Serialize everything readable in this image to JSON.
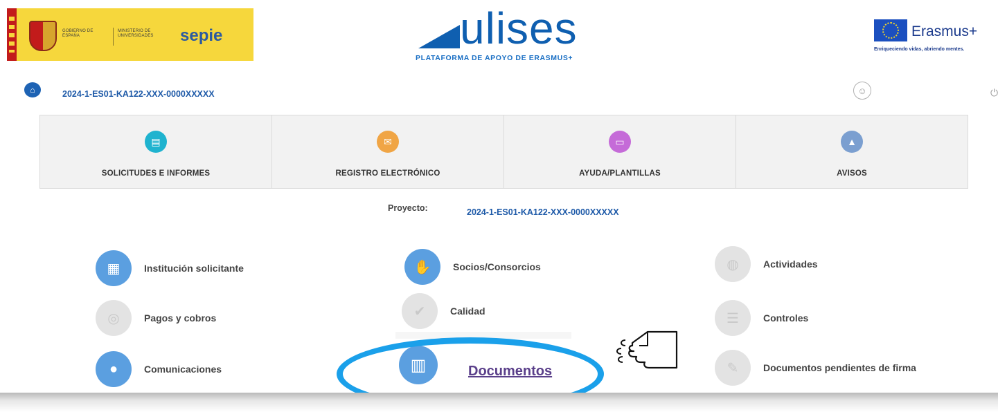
{
  "header": {
    "gov_text_1": "GOBIERNO DE ESPAÑA",
    "gov_text_2": "MINISTERIO DE UNIVERSIDADES",
    "sepie_logo": "sepie",
    "ulises_logo": "ulises",
    "ulises_tagline": "PLATAFORMA DE APOYO DE ERASMUS+",
    "erasmus_logo": "Erasmus+",
    "erasmus_tagline": "Enriqueciendo vidas, abriendo mentes."
  },
  "topbar": {
    "project_code": "2024-1-ES01-KA122-XXX-0000XXXXX"
  },
  "nav": [
    {
      "label": "SOLICITUDES E INFORMES",
      "color": "#1fb3cf",
      "icon": "documents-icon"
    },
    {
      "label": "REGISTRO ELECTRÓNICO",
      "color": "#f0a545",
      "icon": "mail-icon"
    },
    {
      "label": "AYUDA/PLANTILLAS",
      "color": "#c56bd8",
      "icon": "folder-icon"
    },
    {
      "label": "AVISOS",
      "color": "#7b9fd0",
      "icon": "bell-icon"
    }
  ],
  "project": {
    "label": "Proyecto: ",
    "code": "2024-1-ES01-KA122-XXX-0000XXXXX"
  },
  "menu": {
    "institucion": "Institución solicitante",
    "socios": "Socios/Consorcios",
    "actividades": "Actividades",
    "pagos": "Pagos y cobros",
    "calidad": "Calidad",
    "controles": "Controles",
    "comunicaciones": "Comunicaciones",
    "documentos": "Documentos",
    "pendientes": "Documentos pendientes de firma"
  },
  "colors": {
    "accent_blue": "#5b9fe0",
    "highlight_ring": "#1aa0ea",
    "link_purple": "#5a3f8a",
    "code_blue": "#1e5aa8"
  }
}
